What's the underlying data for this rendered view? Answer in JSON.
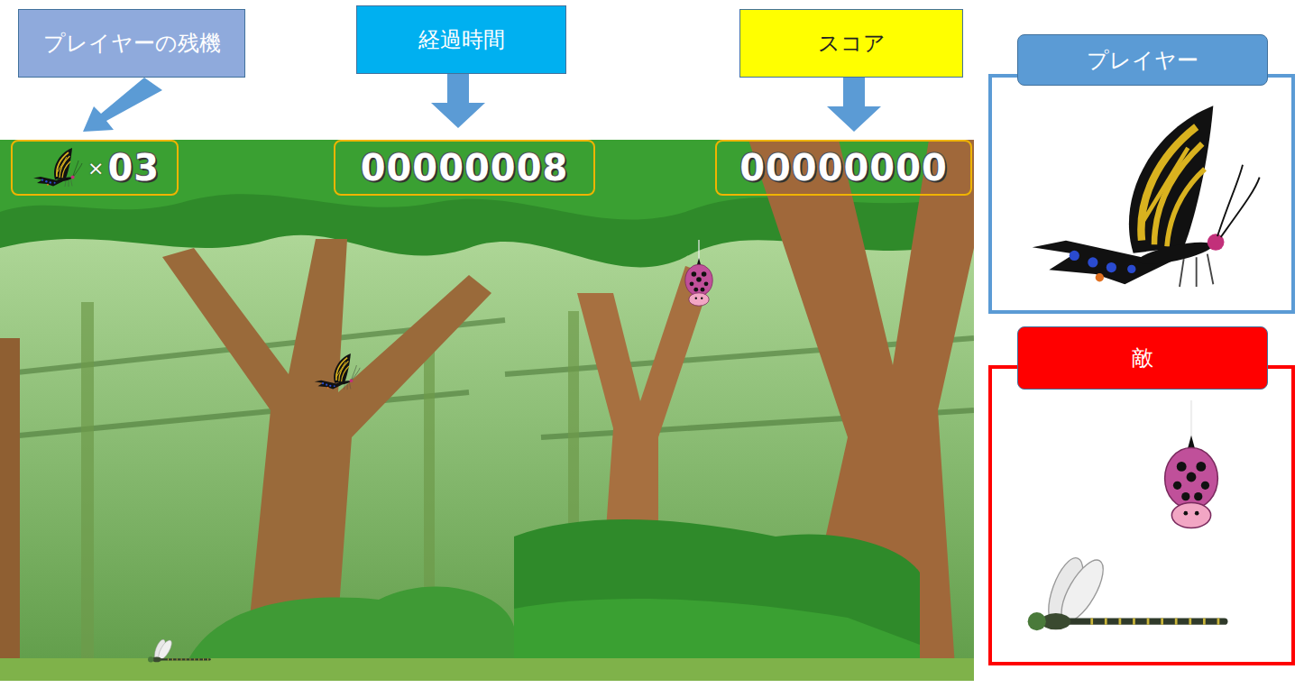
{
  "callouts": [
    {
      "label": "プレイヤーの残機",
      "color": "#8faadc"
    },
    {
      "label": "経過時間",
      "color": "#00b0f0"
    },
    {
      "label": "スコア",
      "color": "#ffff00"
    }
  ],
  "hud": {
    "lives_mark": "×",
    "lives": "03",
    "time": "00000008",
    "score": "00000000"
  },
  "legend": [
    {
      "label": "プレイヤー",
      "kind": "player",
      "color": "#5b9bd5"
    },
    {
      "label": "敵",
      "kind": "enemy",
      "color": "#ff0000"
    }
  ]
}
